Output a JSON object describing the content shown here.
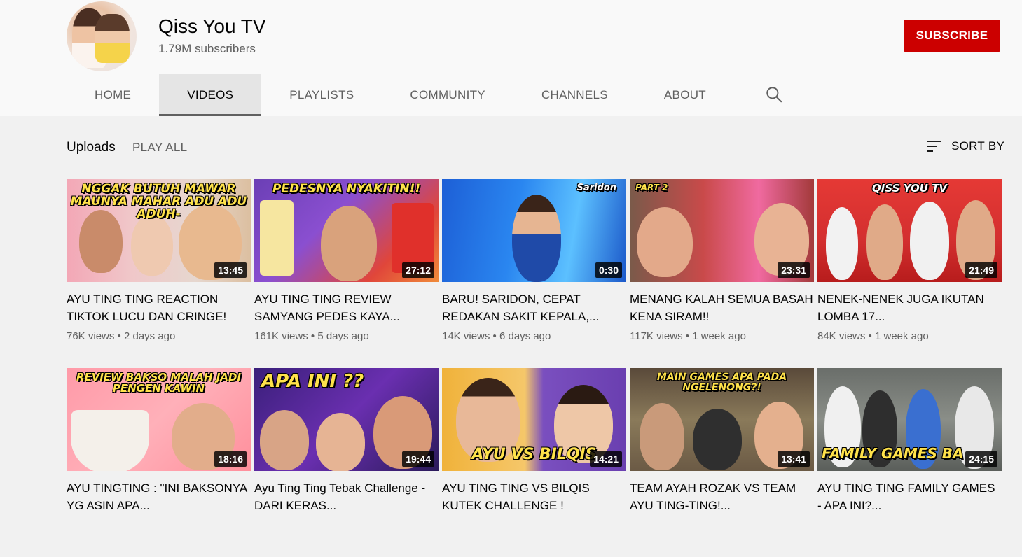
{
  "channel": {
    "name": "Qiss You TV",
    "subscribers": "1.79M subscribers",
    "subscribe_label": "SUBSCRIBE"
  },
  "tabs": [
    {
      "label": "HOME",
      "active": false
    },
    {
      "label": "VIDEOS",
      "active": true
    },
    {
      "label": "PLAYLISTS",
      "active": false
    },
    {
      "label": "COMMUNITY",
      "active": false
    },
    {
      "label": "CHANNELS",
      "active": false
    },
    {
      "label": "ABOUT",
      "active": false
    }
  ],
  "toolbar": {
    "section_title": "Uploads",
    "play_all": "PLAY ALL",
    "sort_by": "SORT BY"
  },
  "colors": {
    "subscribe": "#cc0000",
    "page_bg": "#f1f1f1",
    "header_bg": "#f9f9f9"
  },
  "videos": [
    {
      "title": "AYU TING TING REACTION TIKTOK LUCU DAN CRINGE!",
      "views": "76K views",
      "age": "2 days ago",
      "duration": "13:45",
      "thumb_text": "NGGAK BUTUH MAWAR MAUNYA MAHAR ADU ADU ADUH-",
      "thumb_text_color": "#ffe24a"
    },
    {
      "title": "AYU TING TING REVIEW SAMYANG PEDES KAYA...",
      "views": "161K views",
      "age": "5 days ago",
      "duration": "27:12",
      "thumb_text": "PEDESNYA NYAKITIN!!",
      "thumb_text_color": "#ffe24a"
    },
    {
      "title": "BARU! SARIDON, CEPAT REDAKAN SAKIT KEPALA,...",
      "views": "14K views",
      "age": "6 days ago",
      "duration": "0:30",
      "thumb_text": "Saridon",
      "thumb_text_color": "#ffffff"
    },
    {
      "title": "MENANG KALAH SEMUA BASAH KENA SIRAM!!",
      "views": "117K views",
      "age": "1 week ago",
      "duration": "23:31",
      "thumb_text": "PART 2",
      "thumb_text_color": "#ffe24a"
    },
    {
      "title": "NENEK-NENEK JUGA IKUTAN LOMBA 17...",
      "views": "84K views",
      "age": "1 week ago",
      "duration": "21:49",
      "thumb_text": "QISS YOU TV",
      "thumb_text_color": "#ffffff"
    },
    {
      "title": "AYU TINGTING : \"INI BAKSONYA YG ASIN APA...",
      "views": "",
      "age": "",
      "duration": "18:16",
      "thumb_text": "REVIEW BAKSO MALAH JADI PENGEN KAWIN",
      "thumb_text_color": "#ffe24a"
    },
    {
      "title": "Ayu Ting Ting Tebak Challenge - DARI KERAS...",
      "views": "",
      "age": "",
      "duration": "19:44",
      "thumb_text": "APA INI ??",
      "thumb_text_color": "#ffe24a"
    },
    {
      "title": "AYU TING TING VS BILQIS KUTEK CHALLENGE !",
      "views": "",
      "age": "",
      "duration": "14:21",
      "thumb_text": "AYU VS BILQIS",
      "thumb_text_color": "#ffe24a"
    },
    {
      "title": "TEAM AYAH ROZAK VS TEAM AYU TING-TING!...",
      "views": "",
      "age": "",
      "duration": "13:41",
      "thumb_text": "MAIN GAMES APA PADA NGELENONG?!",
      "thumb_text_color": "#ffe24a"
    },
    {
      "title": "AYU TING TING FAMILY GAMES - APA INI?...",
      "views": "",
      "age": "",
      "duration": "24:15",
      "thumb_text": "FAMILY GAMES BA",
      "thumb_text_color": "#ffe24a"
    }
  ]
}
